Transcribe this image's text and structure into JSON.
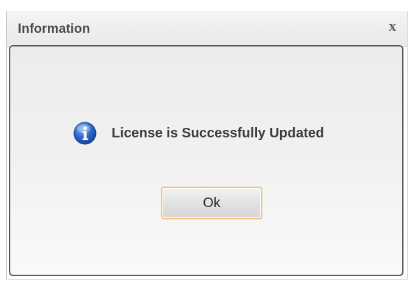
{
  "dialog": {
    "title": "Information",
    "close_glyph": "x",
    "message": "License is Successfully Updated",
    "message_icon": "info-icon",
    "ok_label": "Ok"
  },
  "colors": {
    "title_text": "#4b4b4b",
    "close_glyph": "#5d6671",
    "panel_border": "#595959",
    "message_text": "#3c3c3c",
    "ok_button_border": "#f2c37e",
    "info_icon_blue": "#2c63c9"
  }
}
